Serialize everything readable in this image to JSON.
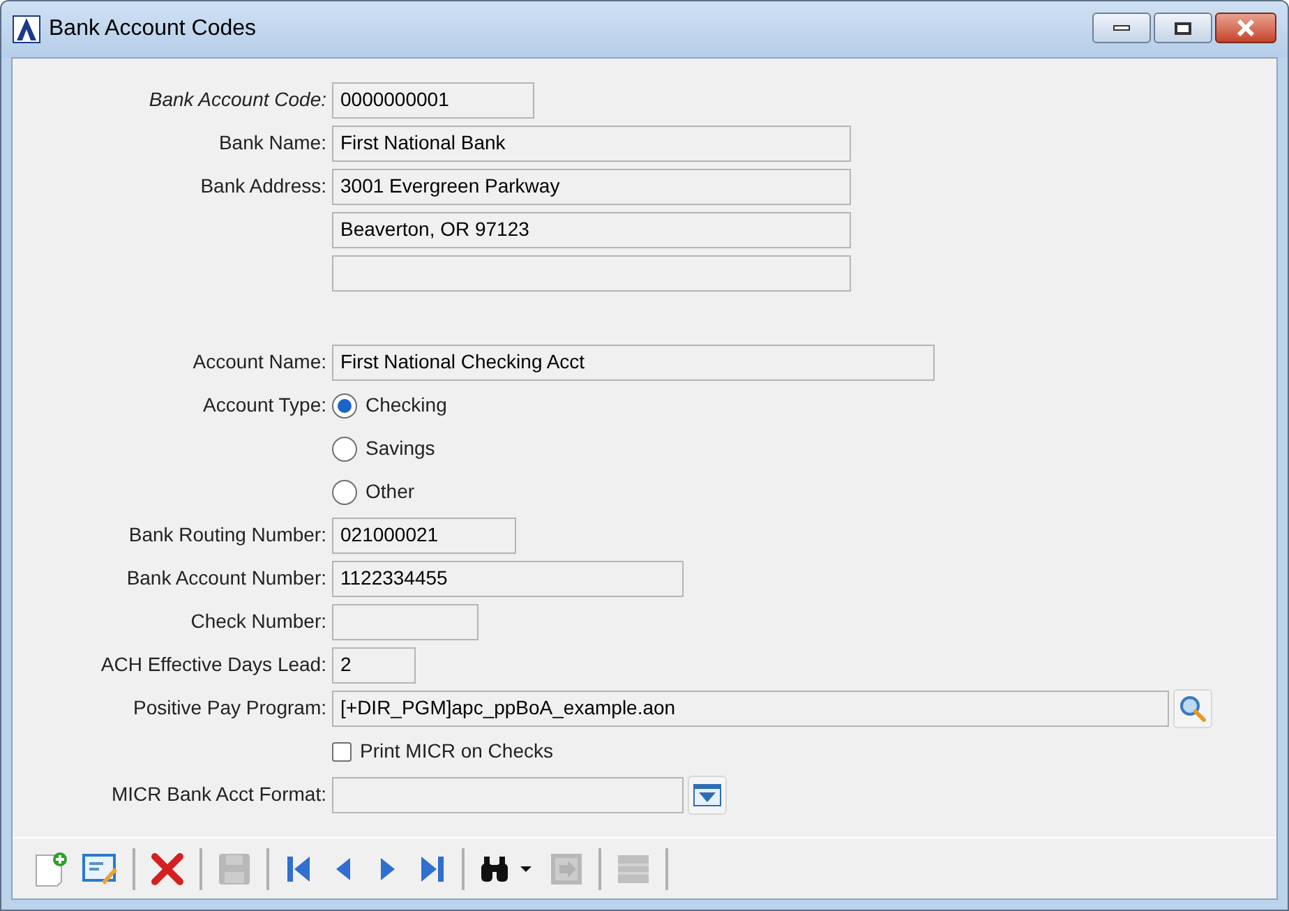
{
  "window": {
    "title": "Bank Account Codes"
  },
  "sections": [
    [
      {
        "kind": "text",
        "label": "Bank Account Code:",
        "key_field": true,
        "value": "0000000001"
      },
      {
        "kind": "text",
        "label": "Bank Name:",
        "key_field": false,
        "value": "First National Bank"
      },
      {
        "kind": "text",
        "label": "Bank Address:",
        "key_field": false,
        "value": "3001 Evergreen Parkway"
      },
      {
        "kind": "text",
        "value": "Beaverton, OR 97123"
      },
      {
        "kind": "text"
      }
    ],
    [
      {
        "kind": "text",
        "label": "Account Name:",
        "key_field": false,
        "value": "First National Checking Acct"
      },
      {
        "kind": "radio",
        "label": "Account Type:",
        "options": [
          {
            "label": "Checking",
            "selected": true
          },
          {
            "label": "Savings",
            "selected": false
          },
          {
            "label": "Other",
            "selected": false
          }
        ]
      },
      {
        "kind": "text",
        "label": "Bank Routing Number:",
        "key_field": false,
        "value": "021000021"
      },
      {
        "kind": "text",
        "label": "Bank Account Number:",
        "key_field": false,
        "value": "1122334455"
      },
      {
        "kind": "text",
        "label": "Check Number:",
        "key_field": false
      },
      {
        "kind": "text",
        "label": "ACH Effective Days Lead:",
        "key_field": false,
        "value": "2"
      },
      {
        "kind": "lookup",
        "label": "Positive Pay Program:",
        "key_field": false,
        "value": "[+DIR_PGM]apc_ppBoA_example.aon"
      },
      {
        "kind": "checkbox",
        "label": "Print MICR on Checks",
        "checked": false
      },
      {
        "kind": "dropdown",
        "label": "MICR Bank Acct Format:",
        "key_field": false
      }
    ]
  ],
  "toolbar": [
    {
      "kind": "new",
      "disabled": false
    },
    {
      "kind": "edit",
      "disabled": false
    },
    {
      "kind": "sep"
    },
    {
      "kind": "delete",
      "disabled": false
    },
    {
      "kind": "sep"
    },
    {
      "kind": "save",
      "disabled": true
    },
    {
      "kind": "sep"
    },
    {
      "kind": "first",
      "disabled": false
    },
    {
      "kind": "prev",
      "disabled": false
    },
    {
      "kind": "next",
      "disabled": false
    },
    {
      "kind": "last",
      "disabled": false
    },
    {
      "kind": "sep"
    },
    {
      "kind": "find",
      "disabled": false
    },
    {
      "kind": "import",
      "disabled": true
    },
    {
      "kind": "sep"
    },
    {
      "kind": "list",
      "disabled": true
    },
    {
      "kind": "sep"
    }
  ]
}
